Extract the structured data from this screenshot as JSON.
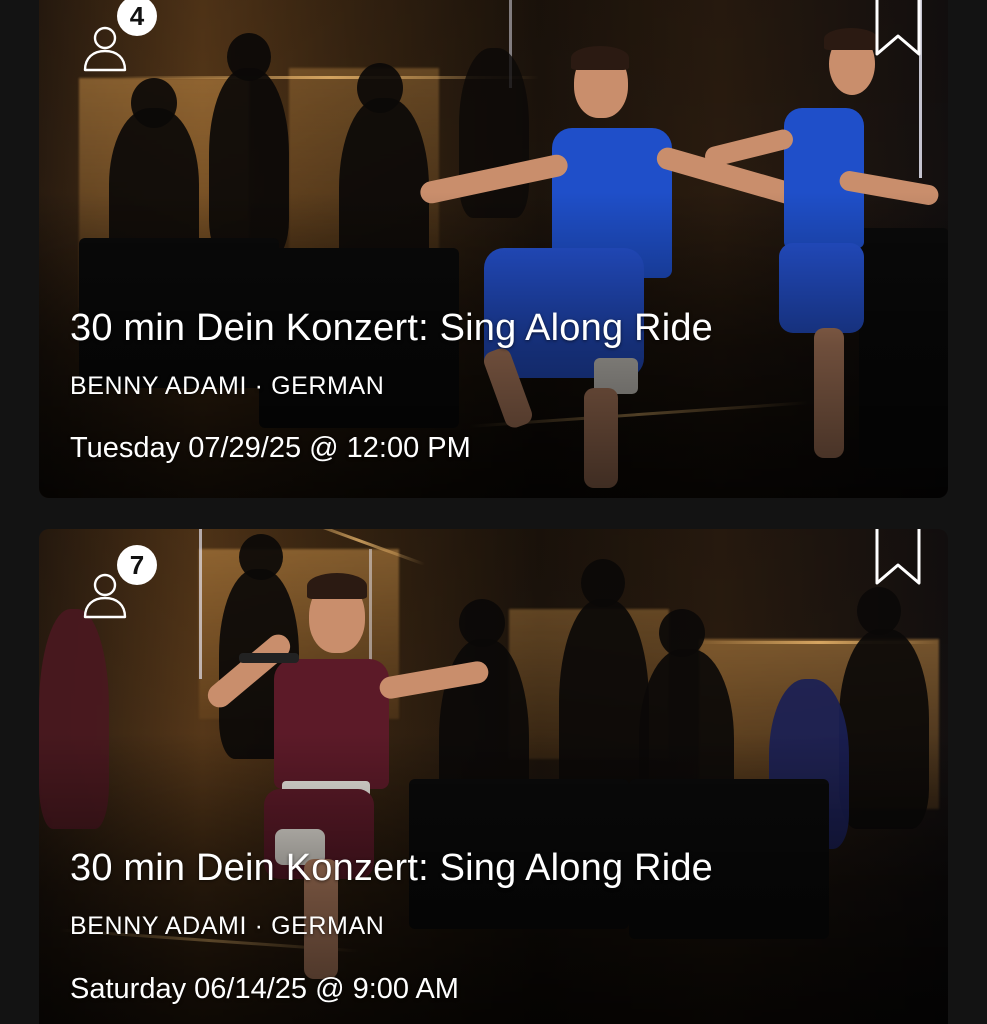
{
  "classes": [
    {
      "title": "30 min Dein Konzert: Sing Along Ride",
      "instructor": "BENNY ADAMI",
      "separator": "·",
      "language": "GERMAN",
      "schedule": "Tuesday 07/29/25 @ 12:00 PM",
      "attendee_count": "4",
      "icons": {
        "attendees": "person-outline-icon",
        "bookmark": "bookmark-outline-icon"
      },
      "instructor_outfit_color": "#1f4fc9"
    },
    {
      "title": "30 min Dein Konzert: Sing Along Ride",
      "instructor": "BENNY ADAMI",
      "separator": "·",
      "language": "GERMAN",
      "schedule": "Saturday 06/14/25 @ 9:00 AM",
      "attendee_count": "7",
      "icons": {
        "attendees": "person-outline-icon",
        "bookmark": "bookmark-outline-icon"
      },
      "instructor_outfit_color": "#5c1a28"
    }
  ],
  "colors": {
    "background": "#131313",
    "text": "#ffffff",
    "badge_bg": "#ffffff",
    "badge_text": "#111111"
  }
}
